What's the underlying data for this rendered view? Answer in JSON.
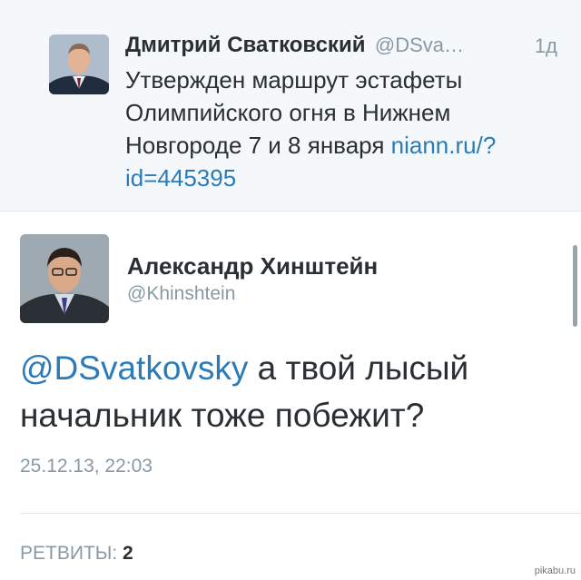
{
  "reply_tweet": {
    "name": "Дмитрий Сватковский",
    "handle": "@DSva…",
    "time": "1д",
    "text_before_link": "Утвержден маршрут эстафеты Олимпийского огня в Нижнем Новгороде 7 и 8 января ",
    "link": "niann.ru/?id=445395"
  },
  "main_tweet": {
    "name": "Александр Хинштейн",
    "handle": "@Khinshtein",
    "mention": "@DSvatkovsky",
    "text": " а твой лысый начальник тоже побежит?",
    "date": "25.12.13, 22:03",
    "retweets_label": "РЕТВИТЫ:",
    "retweets_count": "2"
  },
  "watermark": "pikabu.ru",
  "colors": {
    "link": "#2b7bb9",
    "secondary_text": "#8899a6",
    "reply_background": "#f5f8fa"
  }
}
